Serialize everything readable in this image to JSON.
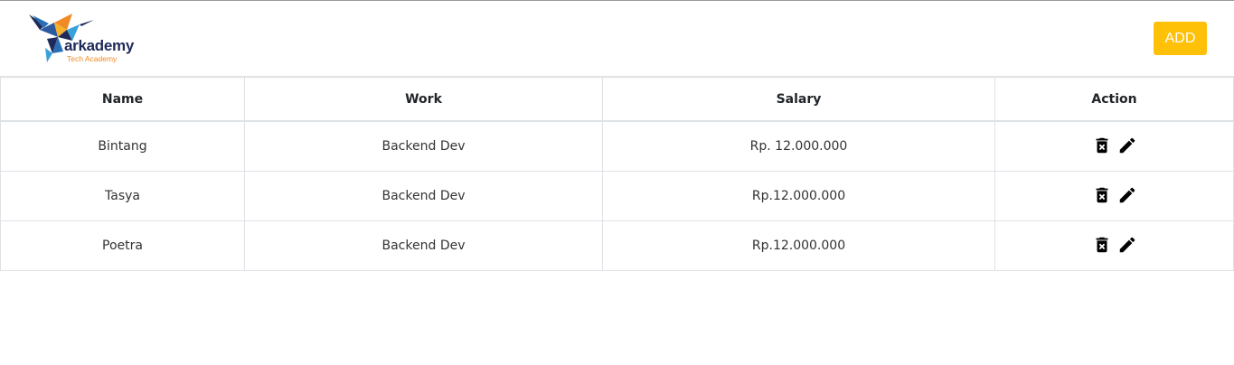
{
  "header": {
    "logo_title": "arkademy",
    "logo_subtitle": "Tech Academy",
    "add_label": "ADD"
  },
  "table": {
    "columns": [
      "Name",
      "Work",
      "Salary",
      "Action"
    ],
    "rows": [
      {
        "name": "Bintang",
        "work": "Backend Dev",
        "salary": "Rp. 12.000.000"
      },
      {
        "name": "Tasya",
        "work": "Backend Dev",
        "salary": "Rp.12.000.000"
      },
      {
        "name": "Poetra",
        "work": "Backend Dev",
        "salary": "Rp.12.000.000"
      }
    ]
  },
  "icons": {
    "delete": "delete-icon",
    "edit": "edit-icon"
  },
  "colors": {
    "accent": "#ffc107",
    "logo_navy": "#1f2a5a",
    "logo_orange": "#f08a24"
  }
}
